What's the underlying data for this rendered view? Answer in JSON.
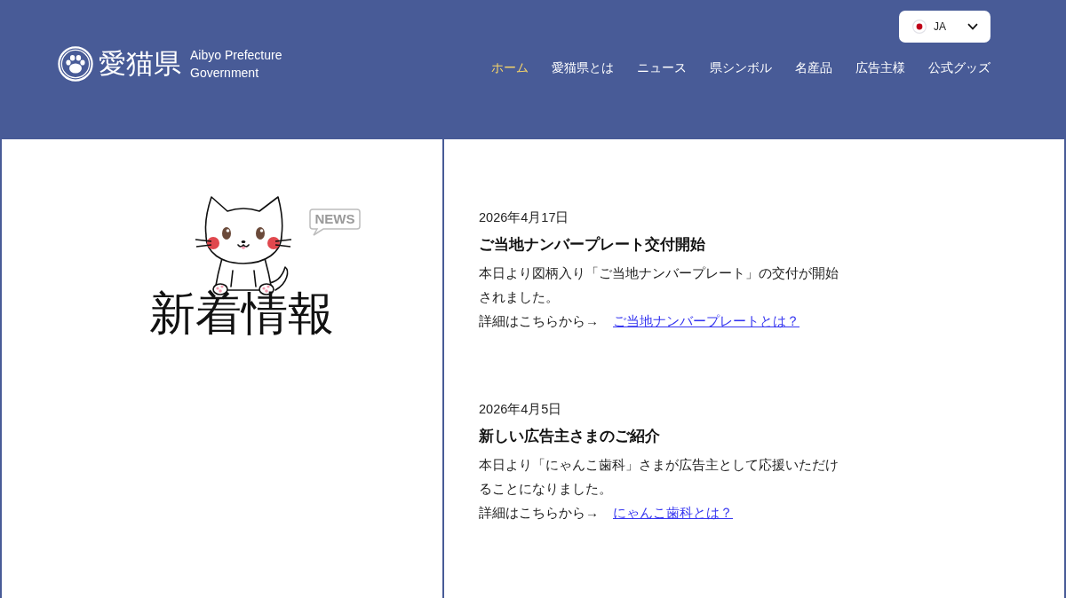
{
  "header": {
    "logo": {
      "name": "愛猫県",
      "subtitle": "Aibyo Prefecture Government"
    },
    "language": {
      "code": "JA"
    },
    "nav": [
      {
        "label": "ホーム",
        "selected": true
      },
      {
        "label": "愛猫県とは",
        "selected": false
      },
      {
        "label": "ニュース",
        "selected": false
      },
      {
        "label": "県シンボル",
        "selected": false
      },
      {
        "label": "名産品",
        "selected": false
      },
      {
        "label": "広告主様",
        "selected": false
      },
      {
        "label": "公式グッズ",
        "selected": false
      }
    ]
  },
  "news_panel": {
    "badge": "NEWS",
    "title": "新着情報"
  },
  "news": [
    {
      "date": "2026年4月17日",
      "title": "ご当地ナンバープレート交付開始",
      "body": "本日より図柄入り「ご当地ナンバープレート」の交付が開始されました。",
      "prompt": "詳細はこちらから→",
      "link": "ご当地ナンバープレートとは？"
    },
    {
      "date": "2026年4月5日",
      "title": "新しい広告主さまのご紹介",
      "body": "本日より「にゃんこ歯科」さまが広告主として応援いただけることになりました。",
      "prompt": "詳細はこちらから→",
      "link": "にゃんこ歯科とは？"
    }
  ]
}
